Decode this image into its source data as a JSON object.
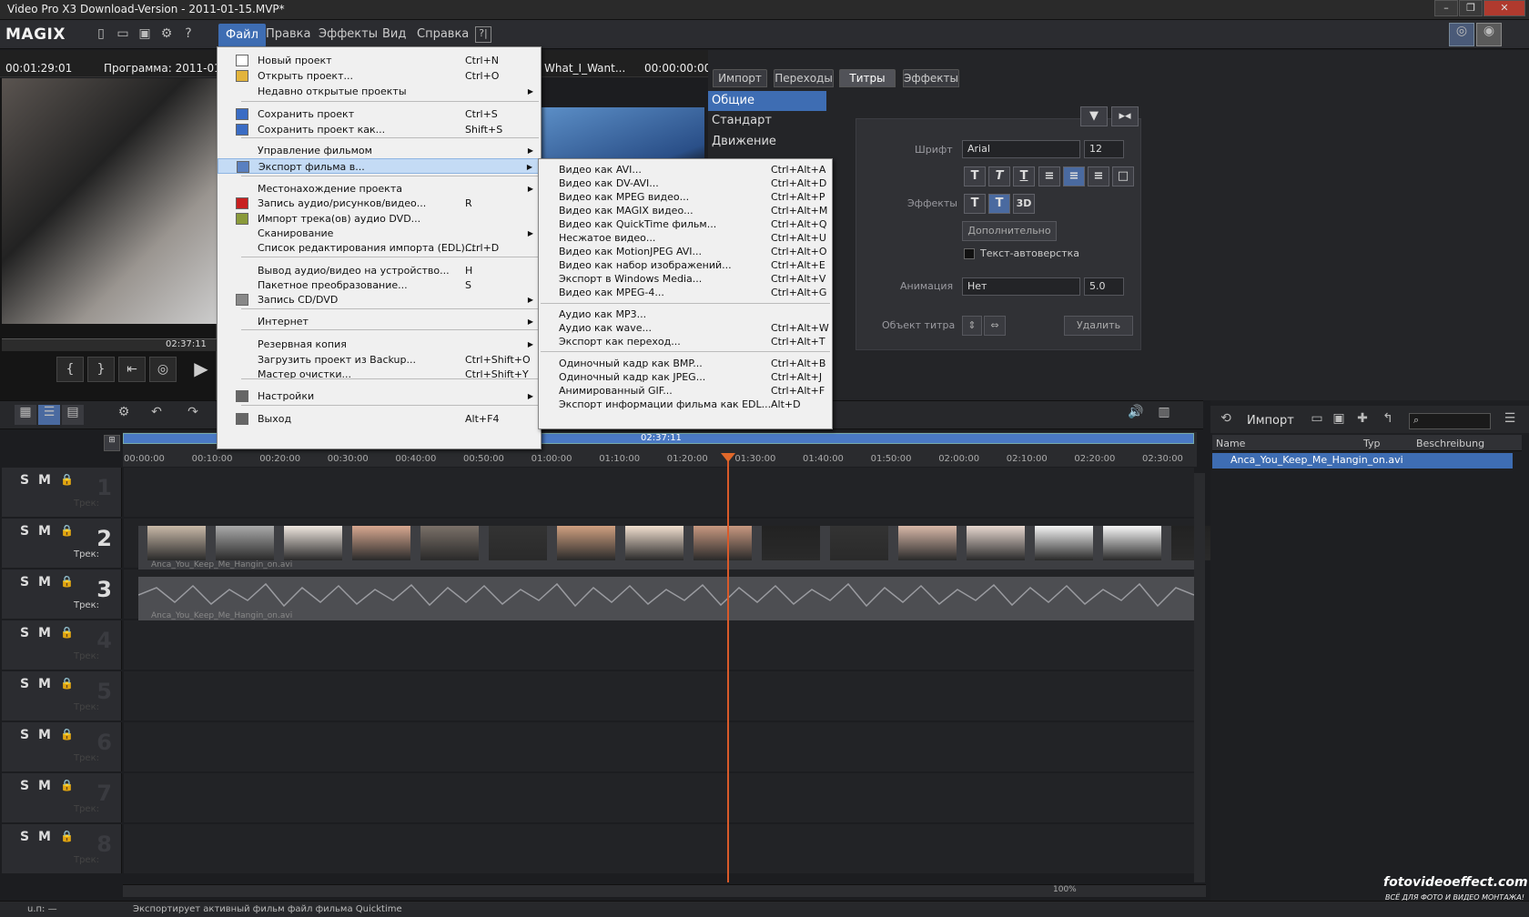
{
  "window": {
    "title": "Video Pro X3 Download-Version - 2011-01-15.MVP*"
  },
  "app": {
    "logo": "MAGIX"
  },
  "menubar": {
    "items": [
      "Файл",
      "Правка",
      "Эффекты",
      "Вид",
      "Справка"
    ],
    "help_icon": "?|"
  },
  "preview": {
    "timecode": "00:01:29:01",
    "program": "Программа: 2011-01-1",
    "ruler_time": "02:37:11"
  },
  "preview2": {
    "title": "What_I_Want...",
    "timecode": "00:00:00:00"
  },
  "tabs": [
    "Импорт",
    "Переходы",
    "Титры",
    "Эффекты"
  ],
  "sidebar": [
    "Общие",
    "Стандарт",
    "Движение"
  ],
  "title_panel": {
    "font_label": "Шрифт",
    "font_value": "Arial",
    "size_value": "12",
    "effects_label": "Эффекты",
    "btn_3d": "3D",
    "more_button": "Дополнительно",
    "autowrap": "Текст-автоверстка",
    "anim_label": "Анимация",
    "anim_value": "Нет",
    "anim_duration": "5.0",
    "object_label": "Объект титра",
    "delete_button": "Удалить"
  },
  "file_menu": [
    {
      "label": "Новый проект",
      "sc": "Ctrl+N"
    },
    {
      "label": "Открыть проект...",
      "sc": "Ctrl+O"
    },
    {
      "label": "Недавно открытые проекты",
      "sc": ""
    },
    {
      "label": "Сохранить проект",
      "sc": "Ctrl+S"
    },
    {
      "label": "Сохранить проект как...",
      "sc": "Shift+S"
    },
    {
      "label": "Управление фильмом",
      "sc": ""
    },
    {
      "label": "Экспорт фильма в...",
      "sc": ""
    },
    {
      "label": "Местонахождение проекта",
      "sc": ""
    },
    {
      "label": "Запись аудио/рисунков/видео...",
      "sc": "R"
    },
    {
      "label": "Импорт трека(ов) аудио DVD...",
      "sc": ""
    },
    {
      "label": "Сканирование",
      "sc": ""
    },
    {
      "label": "Список редактирования импорта (EDL)...",
      "sc": "Ctrl+D"
    },
    {
      "label": "Вывод аудио/видео на устройство...",
      "sc": "H"
    },
    {
      "label": "Пакетное преобразование...",
      "sc": "S"
    },
    {
      "label": "Запись CD/DVD",
      "sc": ""
    },
    {
      "label": "Интернет",
      "sc": ""
    },
    {
      "label": "Резервная копия",
      "sc": ""
    },
    {
      "label": "Загрузить проект из Backup...",
      "sc": "Ctrl+Shift+O"
    },
    {
      "label": "Мастер очистки...",
      "sc": "Ctrl+Shift+Y"
    },
    {
      "label": "Настройки",
      "sc": ""
    },
    {
      "label": "Выход",
      "sc": "Alt+F4"
    }
  ],
  "export_menu": [
    {
      "label": "Видео как AVI...",
      "sc": "Ctrl+Alt+A"
    },
    {
      "label": "Видео как DV-AVI...",
      "sc": "Ctrl+Alt+D"
    },
    {
      "label": "Видео как MPEG видео...",
      "sc": "Ctrl+Alt+P"
    },
    {
      "label": "Видео как MAGIX видео...",
      "sc": "Ctrl+Alt+M"
    },
    {
      "label": "Видео как QuickTime фильм...",
      "sc": "Ctrl+Alt+Q"
    },
    {
      "label": "Несжатое видео...",
      "sc": "Ctrl+Alt+U"
    },
    {
      "label": "Видео как MotionJPEG AVI...",
      "sc": "Ctrl+Alt+O"
    },
    {
      "label": "Видео как набор изображений...",
      "sc": "Ctrl+Alt+E"
    },
    {
      "label": "Экспорт в Windows Media...",
      "sc": "Ctrl+Alt+V"
    },
    {
      "label": "Видео как MPEG-4...",
      "sc": "Ctrl+Alt+G"
    },
    {
      "label": "Аудио как MP3...",
      "sc": ""
    },
    {
      "label": "Аудио как wave...",
      "sc": "Ctrl+Alt+W"
    },
    {
      "label": "Экспорт как переход...",
      "sc": "Ctrl+Alt+T"
    },
    {
      "label": "Одиночный кадр как BMP...",
      "sc": "Ctrl+Alt+B"
    },
    {
      "label": "Одиночный кадр как JPEG...",
      "sc": "Ctrl+Alt+J"
    },
    {
      "label": "Анимированный GIF...",
      "sc": "Ctrl+Alt+F"
    },
    {
      "label": "Экспорт информации фильма как EDL...",
      "sc": "Alt+D"
    }
  ],
  "timeline": {
    "bar_time": "02:37:11",
    "ticks": [
      "00:00:00",
      "00:10:00",
      "00:20:00",
      "00:30:00",
      "00:40:00",
      "00:50:00",
      "01:00:00",
      "01:10:00",
      "01:20:00",
      "01:30:00",
      "01:40:00",
      "01:50:00",
      "02:00:00",
      "02:10:00",
      "02:20:00",
      "02:30:00"
    ],
    "zoom": "100%",
    "clip_name": "Anca_You_Keep_Me_Hangin_on.avi",
    "track_label": "Трек:"
  },
  "tracks": [
    "1",
    "2",
    "3",
    "4",
    "5",
    "6",
    "7",
    "8"
  ],
  "media_pool": {
    "title": "Импорт",
    "columns": [
      "Name",
      "Typ",
      "Beschreibung"
    ],
    "file": "Anca_You_Keep_Me_Hangin_on.avi"
  },
  "status": {
    "left": "u.п: —",
    "text": "Экспортирует активный фильм файл фильма Quicktime"
  },
  "watermark": {
    "site": "fotovideoeffect.com",
    "sub": "ВСЁ ДЛЯ ФОТО И ВИДЕО МОНТАЖА!"
  }
}
